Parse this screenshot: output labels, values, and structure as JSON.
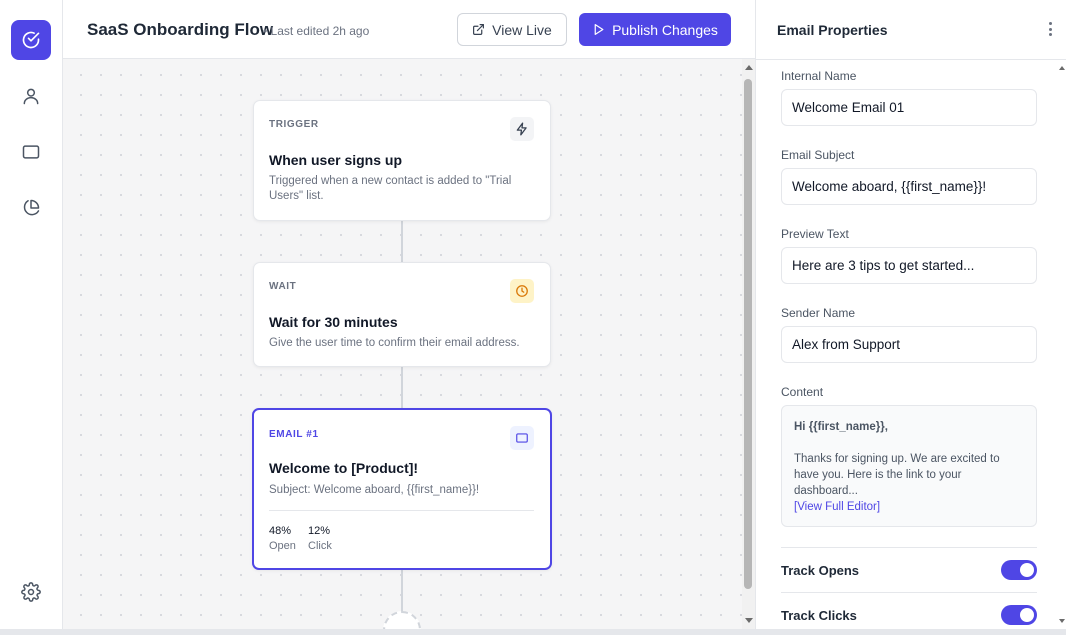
{
  "rail": {
    "items": [
      {
        "icon": "check-circle-icon",
        "active": true
      },
      {
        "icon": "user-icon",
        "active": false
      },
      {
        "icon": "square-icon",
        "active": false
      },
      {
        "icon": "pie-chart-icon",
        "active": false
      }
    ],
    "settings_icon": "gear-icon"
  },
  "header": {
    "title": "SaaS Onboarding Flow",
    "edited": "• Last edited 2h ago",
    "view_live_label": "View Live",
    "publish_label": "Publish Changes"
  },
  "nodes": [
    {
      "type": "TRIGGER",
      "icon": "lightning-icon",
      "title": "When user signs up",
      "description": "Triggered when a new contact is added to \"Trial Users\" list."
    },
    {
      "type": "WAIT",
      "icon": "clock-icon",
      "title": "Wait for 30 minutes",
      "description": "Give the user time to confirm their email address."
    },
    {
      "type": "EMAIL #1",
      "icon": "email-icon",
      "title": "Welcome to [Product]!",
      "description": "Subject: Welcome aboard, {{first_name}}!",
      "stats": [
        {
          "value": "48%",
          "label": "Open"
        },
        {
          "value": "12%",
          "label": "Click"
        }
      ]
    }
  ],
  "panel": {
    "title": "Email Properties",
    "fields": [
      {
        "label": "Internal Name",
        "value": "Welcome Email 01"
      },
      {
        "label": "Email Subject",
        "value": "Welcome aboard, {{first_name}}!"
      },
      {
        "label": "Preview Text",
        "value": "Here are 3 tips to get started..."
      },
      {
        "label": "Sender Name",
        "value": "Alex from Support"
      }
    ],
    "content": {
      "label": "Content",
      "greeting": "Hi {{first_name}},",
      "body": "Thanks for signing up. We are excited to have you. Here is the link to your dashboard...",
      "link": "[View Full Editor]"
    },
    "toggles": [
      {
        "label": "Track Opens",
        "on": true
      },
      {
        "label": "Track Clicks",
        "on": true
      }
    ]
  },
  "colors": {
    "accent": "#4f46e5",
    "wait_icon_bg": "#fef3c7",
    "wait_icon": "#d97706"
  }
}
